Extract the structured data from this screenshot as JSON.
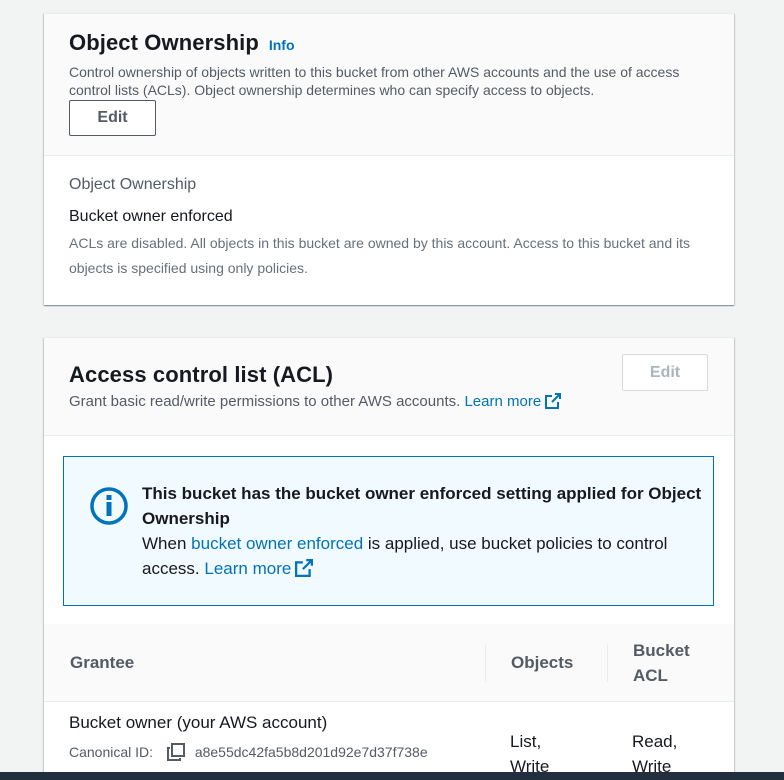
{
  "ownership": {
    "title": "Object Ownership",
    "info": "Info",
    "description": "Control ownership of objects written to this bucket from other AWS accounts and the use of access control lists (ACLs). Object ownership determines who can specify access to objects.",
    "edit_label": "Edit",
    "field_label": "Object Ownership",
    "field_value": "Bucket owner enforced",
    "field_desc": "ACLs are disabled. All objects in this bucket are owned by this account. Access to this bucket and its objects is specified using only policies."
  },
  "acl": {
    "title": "Access control list (ACL)",
    "edit_label": "Edit",
    "description": "Grant basic read/write permissions to other AWS accounts.",
    "learn_more": "Learn more",
    "alert": {
      "title": "This bucket has the bucket owner enforced setting applied for Object Ownership",
      "text_before": "When",
      "link": "bucket owner enforced",
      "text_after": "is applied, use bucket policies to control access.",
      "learn_more": "Learn more"
    },
    "table": {
      "headers": {
        "grantee": "Grantee",
        "objects": "Objects",
        "bucket_acl": "Bucket ACL"
      },
      "rows": [
        {
          "grantee": "Bucket owner (your AWS account)",
          "canonical_label": "Canonical ID:",
          "canonical_id": "a8e55dc42fa5b8d201d92e7d37f738e",
          "objects": "List, Write",
          "bucket_acl": "Read, Write"
        }
      ]
    }
  },
  "colors": {
    "link": "#0073bb",
    "alert_bg": "#f1faff",
    "page_bg": "#f2f3f3"
  },
  "icons": [
    "info-icon",
    "external-link-icon",
    "copy-icon"
  ]
}
